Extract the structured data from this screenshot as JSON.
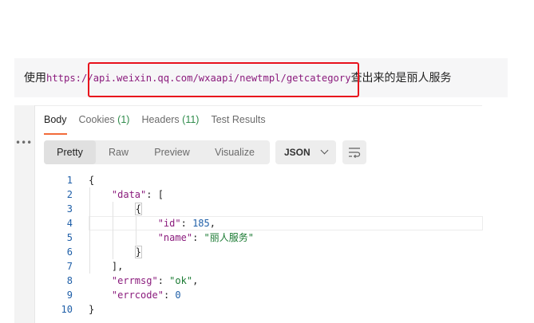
{
  "note": {
    "prefix": "使用",
    "url_head": "https:/",
    "url_body": "/api.weixin.qq.com/wxaapi/newtmpl/getcategory",
    "suffix": "查出来的是丽人服务"
  },
  "tabs": [
    {
      "label": "Body",
      "count": ""
    },
    {
      "label": "Cookies",
      "count": "(1)"
    },
    {
      "label": "Headers",
      "count": "(11)"
    },
    {
      "label": "Test Results",
      "count": ""
    }
  ],
  "view_modes": [
    "Pretty",
    "Raw",
    "Preview",
    "Visualize"
  ],
  "format_select": "JSON",
  "more_icon": "•••",
  "code": {
    "line_numbers": [
      "1",
      "2",
      "3",
      "4",
      "5",
      "6",
      "7",
      "8",
      "9",
      "10"
    ],
    "data_key": "\"data\"",
    "id_key": "\"id\"",
    "id_value": "185",
    "name_key": "\"name\"",
    "name_value": "\"丽人服务\"",
    "errmsg_key": "\"errmsg\"",
    "errmsg_value": "\"ok\"",
    "errcode_key": "\"errcode\"",
    "errcode_value": "0"
  },
  "colors": {
    "accent_tab": "#f26b3a",
    "highlight_box": "#e8111c",
    "key": "#8b1c7d",
    "string": "#1a7a32",
    "number": "#1f5fa8"
  },
  "icons": [
    "more-icon",
    "chevron-down-icon",
    "wrap-lines-icon"
  ]
}
